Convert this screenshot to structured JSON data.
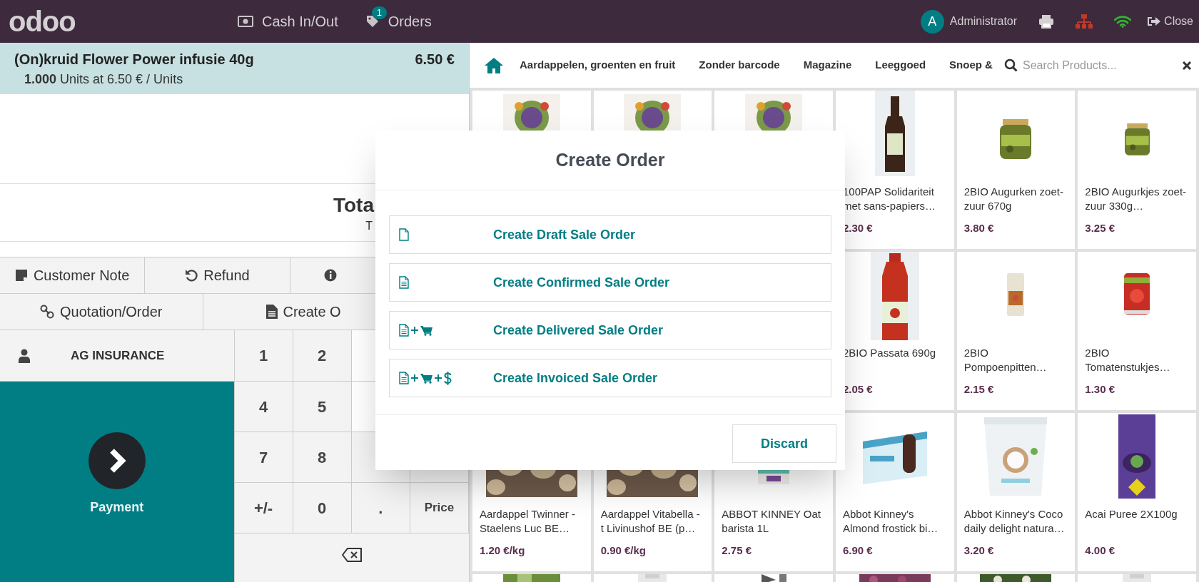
{
  "header": {
    "logo": "odoo",
    "actions": [
      {
        "kind": "cash",
        "label": "Cash In/Out"
      },
      {
        "kind": "orders",
        "label": "Orders",
        "badge": "1"
      }
    ],
    "user": {
      "initial": "A",
      "name": "Administrator"
    },
    "close": "Close"
  },
  "order": {
    "lines": [
      {
        "name": "(On)kruid Flower Power infusie 40g",
        "price": "6.50 €",
        "quantity": "1.000",
        "detail": "Units at 6.50 € / Units",
        "selected": true
      }
    ],
    "total_label": "Tota",
    "taxes_label": "T"
  },
  "control_rows": [
    [
      {
        "kind": "note",
        "label": "Customer Note"
      },
      {
        "kind": "refund",
        "label": "Refund"
      },
      {
        "kind": "info"
      }
    ],
    [
      {
        "kind": "link",
        "label": "Quotation/Order"
      },
      {
        "kind": "document",
        "label": "Create O"
      }
    ]
  ],
  "customer": {
    "label": "AG INSURANCE"
  },
  "payment": {
    "label": "Payment"
  },
  "numpad": {
    "rows": [
      [
        "1",
        "2"
      ],
      [
        "4",
        "5"
      ],
      [
        "7",
        "8"
      ],
      [
        "+/-",
        "0",
        ".",
        "Price"
      ]
    ]
  },
  "categories": [
    {
      "label": "Aardappelen, groenten en fruit"
    },
    {
      "label": "Zonder barcode"
    },
    {
      "label": "Magazine"
    },
    {
      "label": "Leeggoed"
    },
    {
      "label": "Snoep &"
    }
  ],
  "search": {
    "placeholder": "Search Products..."
  },
  "products": [
    {
      "kind": "picture"
    },
    {
      "kind": "picture"
    },
    {
      "kind": "picture"
    },
    {
      "name": "100PAP Solidariteit met sans-papiers…",
      "price": "2.30 €"
    },
    {
      "name": "2BIO Augurken zoet-zuur 670g",
      "price": "3.80 €"
    },
    {
      "name": "2BIO Augurkjes zoet-zuur 330g…",
      "price": "3.25 €"
    },
    {
      "kind": "hidden"
    },
    {
      "kind": "hidden"
    },
    {
      "kind": "hidden"
    },
    {
      "name": "2BIO Passata 690g",
      "price": "2.05 €"
    },
    {
      "name": "2BIO Pompoenpitten…",
      "price": "2.15 €"
    },
    {
      "name": "2BIO Tomatenstukjes…",
      "price": "1.30 €"
    },
    {
      "name": "Aardappel Twinner - Staelens Luc BE…",
      "price": "1.20 €/kg"
    },
    {
      "name": "Aardappel Vitabella - t Livinushof BE (p…",
      "price": "0.90 €/kg"
    },
    {
      "name": "ABBOT KINNEY Oat barista 1L",
      "price": "2.75 €"
    },
    {
      "name": "Abbot Kinney's Almond frostick bi…",
      "price": "6.90 €"
    },
    {
      "name": "Abbot Kinney's Coco daily delight natura…",
      "price": "3.20 €"
    },
    {
      "name": "Acai Puree 2X100g",
      "price": "4.00 €"
    },
    {
      "kind": "picture"
    },
    {
      "kind": "picture"
    },
    {
      "kind": "picture"
    },
    {
      "kind": "picture"
    },
    {
      "kind": "picture"
    },
    {
      "kind": "picture"
    }
  ],
  "dialog": {
    "title": "Create Order",
    "options": [
      {
        "kind": "draft",
        "label": "Create Draft Sale Order"
      },
      {
        "kind": "confirmed",
        "label": "Create Confirmed Sale Order"
      },
      {
        "kind": "delivered",
        "label": "Create Delivered Sale Order"
      },
      {
        "kind": "invoiced",
        "label": "Create Invoiced Sale Order"
      }
    ],
    "discard": "Discard"
  }
}
